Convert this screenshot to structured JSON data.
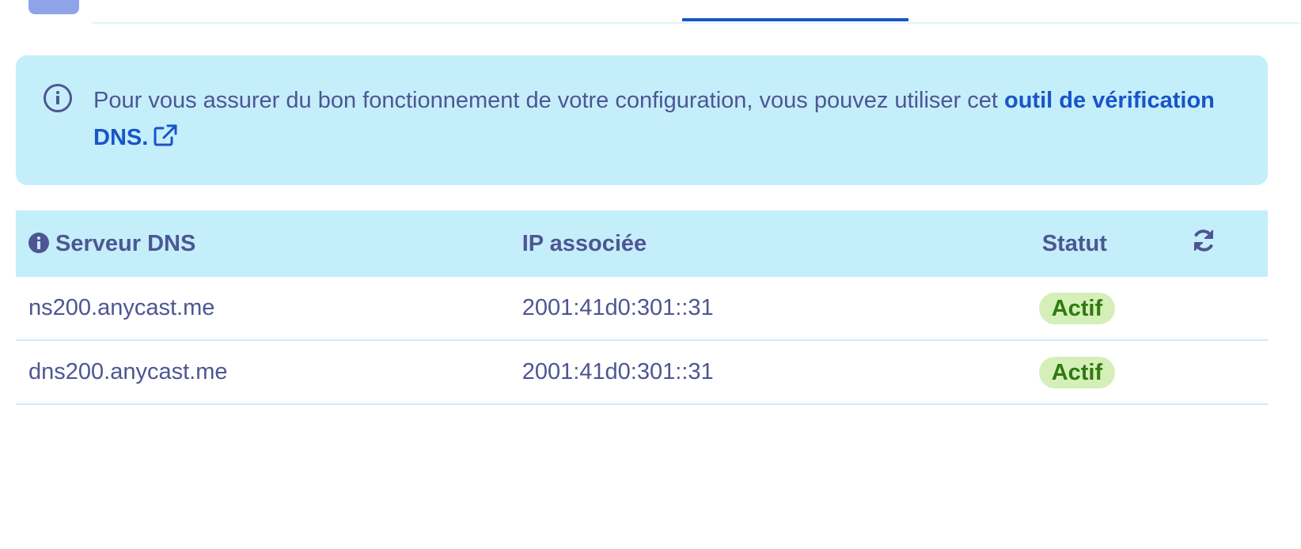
{
  "banner": {
    "text": "Pour vous assurer du bon fonctionnement de votre configuration, vous pouvez utiliser cet ",
    "link_label": "outil de vérification DNS."
  },
  "table": {
    "headers": {
      "server": "Serveur DNS",
      "ip": "IP associée",
      "status": "Statut"
    },
    "rows": [
      {
        "server": "ns200.anycast.me",
        "ip": "2001:41d0:301::31",
        "status": "Actif"
      },
      {
        "server": "dns200.anycast.me",
        "ip": "2001:41d0:301::31",
        "status": "Actif"
      }
    ]
  },
  "colors": {
    "accent": "#1855c8",
    "text": "#4d5693",
    "banner_bg": "#c5eefb",
    "status_bg": "#d5efb8",
    "status_text": "#2f7a11"
  },
  "icons": {
    "banner": "info-circle-icon",
    "link": "external-link-icon",
    "header": "info-filled-icon",
    "refresh": "refresh-icon"
  }
}
